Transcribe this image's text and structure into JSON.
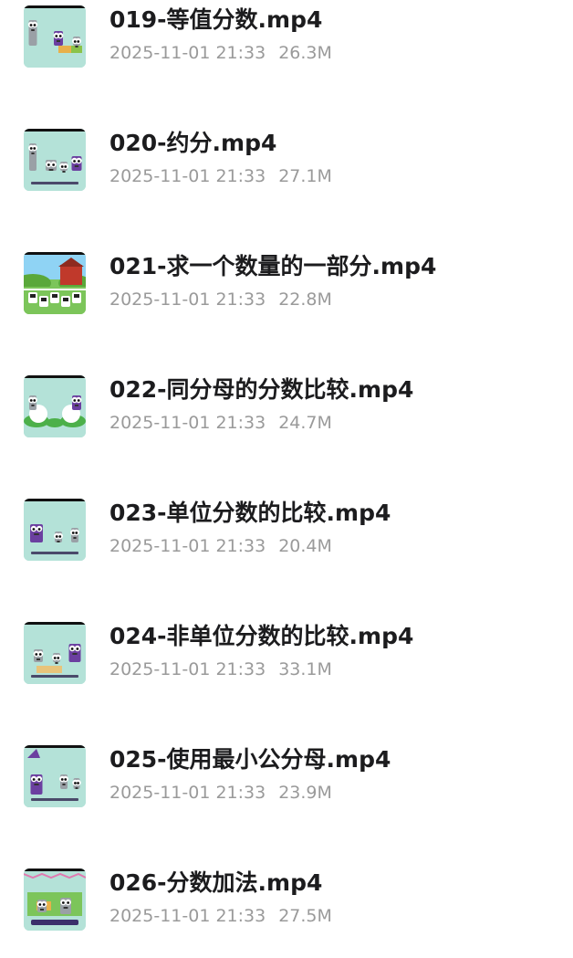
{
  "files": [
    {
      "name": "019-等值分数.mp4",
      "date": "2025-11-01 21:33",
      "size": "26.3M",
      "thumb_icon": "video-thumbnail-icon",
      "thumb_bg": "#b4e2d8"
    },
    {
      "name": "020-约分.mp4",
      "date": "2025-11-01 21:33",
      "size": "27.1M",
      "thumb_icon": "video-thumbnail-icon",
      "thumb_bg": "#b4e2d8"
    },
    {
      "name": "021-求一个数量的一部分.mp4",
      "date": "2025-11-01 21:33",
      "size": "22.8M",
      "thumb_icon": "video-thumbnail-icon",
      "thumb_bg": "#7cc55a"
    },
    {
      "name": "022-同分母的分数比较.mp4",
      "date": "2025-11-01 21:33",
      "size": "24.7M",
      "thumb_icon": "video-thumbnail-icon",
      "thumb_bg": "#b4e2d8"
    },
    {
      "name": "023-单位分数的比较.mp4",
      "date": "2025-11-01 21:33",
      "size": "20.4M",
      "thumb_icon": "video-thumbnail-icon",
      "thumb_bg": "#b4e2d8"
    },
    {
      "name": "024-非单位分数的比较.mp4",
      "date": "2025-11-01 21:33",
      "size": "33.1M",
      "thumb_icon": "video-thumbnail-icon",
      "thumb_bg": "#b4e2d8"
    },
    {
      "name": "025-使用最小公分母.mp4",
      "date": "2025-11-01 21:33",
      "size": "23.9M",
      "thumb_icon": "video-thumbnail-icon",
      "thumb_bg": "#b4e2d8"
    },
    {
      "name": "026-分数加法.mp4",
      "date": "2025-11-01 21:33",
      "size": "27.5M",
      "thumb_icon": "video-thumbnail-icon",
      "thumb_bg": "#b4e2d8"
    }
  ],
  "colors": {
    "title_text": "#1c1c1e",
    "meta_text": "#9a9a9a",
    "character_purple": "#6b3fa0",
    "character_gray": "#9aa0a6",
    "barn_red": "#c0392b",
    "sky_blue": "#8fd3f4"
  }
}
